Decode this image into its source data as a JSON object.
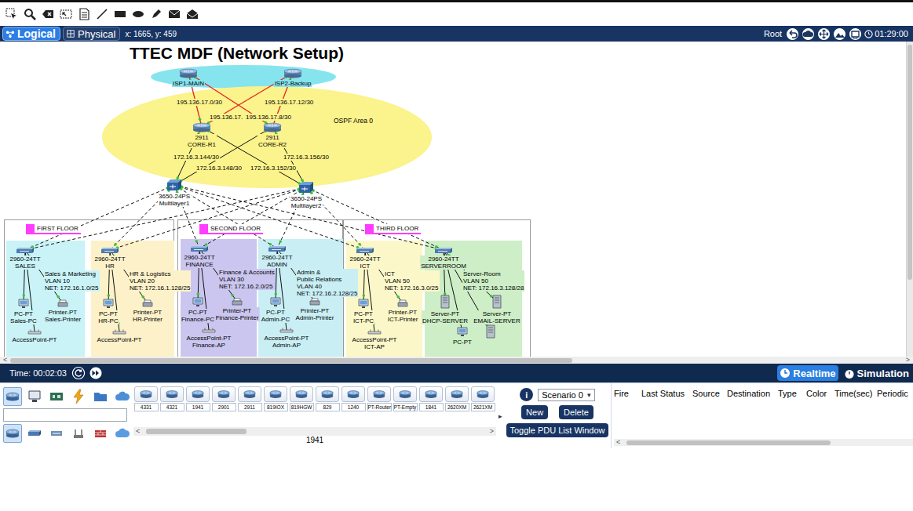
{
  "view_bar": {
    "tabs": [
      {
        "label": "Logical",
        "selected": true
      },
      {
        "label": "Physical",
        "selected": false
      }
    ],
    "cursor": "x: 1665, y: 459",
    "user": "Root",
    "clock": "01:29:00"
  },
  "diagram": {
    "title": "TTEC MDF (Network Setup)",
    "isps": [
      {
        "label": [
          "ISP1-MAIN"
        ]
      },
      {
        "label": [
          "ISP2-Backup"
        ]
      }
    ],
    "cores": [
      {
        "label": [
          "2911",
          "CORE-R1"
        ]
      },
      {
        "label": [
          "2911",
          "CORE-R2"
        ]
      }
    ],
    "distribution": [
      {
        "label": [
          "3650-24PS",
          "Multilayer1"
        ]
      },
      {
        "label": [
          "3650-24PS",
          "Multilayer2"
        ]
      }
    ],
    "ospf_area": "OSPF Area 0",
    "subnets": [
      "195.136.17.0/30",
      "195.136.17.12/30",
      "195.136.17.",
      "195.136.17.8/30",
      "172.16.3.144/30",
      "172.16.3.148/30",
      "172.16.3.152/30",
      "172.16.3.156/30"
    ],
    "link_kinds": {
      "isp_core": "serial",
      "core_distribution": "copper",
      "distribution_access": "dashed",
      "access_device": "copper"
    },
    "floors": [
      {
        "label": "FIRST FLOOR",
        "departments": [
          {
            "switch": [
              "2960-24TT",
              "SALES"
            ],
            "info": [
              "Sales & Marketing",
              "VLAN 10",
              "NET: 172.16.1.0/25"
            ],
            "color": "#c9f3f7",
            "devices": [
              {
                "kind": "pc",
                "label": [
                  "PC-PT",
                  "Sales-PC"
                ]
              },
              {
                "kind": "printer",
                "label": [
                  "Printer-PT",
                  "Sales-Printer"
                ]
              },
              {
                "kind": "ap",
                "label": [
                  "AccessPoint-PT"
                ]
              }
            ]
          },
          {
            "switch": [
              "2960-24TT",
              "HR"
            ],
            "info": [
              "HR & Logistics",
              "VLAN 20",
              "NET: 172.16.1.128/25"
            ],
            "color": "#fdf1c9",
            "devices": [
              {
                "kind": "pc",
                "label": [
                  "PC-PT",
                  "HR-PC"
                ]
              },
              {
                "kind": "printer",
                "label": [
                  "Printer-PT",
                  "HR-Printer"
                ]
              },
              {
                "kind": "ap",
                "label": [
                  "AccessPoint-PT"
                ]
              }
            ]
          }
        ]
      },
      {
        "label": "SECOND FLOOR",
        "departments": [
          {
            "switch": [
              "2960-24TT",
              "FINANCE"
            ],
            "info": [
              "Finance & Accounts",
              "VLAN 30",
              "NET: 172.16.2.0/25"
            ],
            "color": "#cbc6ef",
            "devices": [
              {
                "kind": "pc",
                "label": [
                  "PC-PT",
                  "Finance-PC"
                ]
              },
              {
                "kind": "printer",
                "label": [
                  "Printer-PT",
                  "Finance-Printer"
                ]
              },
              {
                "kind": "ap",
                "label": [
                  "AccessPoint-PT",
                  "Finance-AP"
                ]
              }
            ]
          },
          {
            "switch": [
              "2960-24TT",
              "ADMIN"
            ],
            "info": [
              "Admin &",
              "Public Relations",
              "VLAN 40",
              "NET: 172.16.2.128/25"
            ],
            "color": "#c9eff5",
            "devices": [
              {
                "kind": "pc",
                "label": [
                  "PC-PT",
                  "Admin-PC"
                ]
              },
              {
                "kind": "printer",
                "label": [
                  "Printer-PT",
                  "Admin-Printer"
                ]
              },
              {
                "kind": "ap",
                "label": [
                  "AccessPoint-PT",
                  "Admin-AP"
                ]
              }
            ]
          }
        ]
      },
      {
        "label": "THIRD FLOOR",
        "departments": [
          {
            "switch": [
              "2960-24TT",
              "ICT"
            ],
            "info": [
              "ICT",
              "VLAN 50",
              "NET: 172.16.3.0/25"
            ],
            "color": "#fbf7c8",
            "devices": [
              {
                "kind": "pc",
                "label": [
                  "PC-PT",
                  "ICT-PC"
                ]
              },
              {
                "kind": "printer",
                "label": [
                  "Printer-PT",
                  "ICT-Printer"
                ]
              },
              {
                "kind": "ap",
                "label": [
                  "AccessPoint-PT",
                  "ICT-AP"
                ]
              }
            ]
          },
          {
            "switch": [
              "2960-24TT",
              "SERVERROOM"
            ],
            "info": [
              "Server-Room",
              "VLAN 50",
              "NET: 172.16.3.128/28"
            ],
            "color": "#cdeec6",
            "devices": [
              {
                "kind": "server",
                "label": [
                  "Server-PT",
                  "DHCP-SERVER"
                ]
              },
              {
                "kind": "server",
                "label": [
                  "Server-PT",
                  "EMAIL-SERVER"
                ]
              },
              {
                "kind": "pc",
                "label": [
                  "PC-PT"
                ]
              },
              {
                "kind": "server",
                "label": []
              }
            ]
          }
        ]
      }
    ]
  },
  "sim_bar": {
    "time": "Time: 00:02:03",
    "modes": [
      {
        "label": "Realtime",
        "selected": true
      },
      {
        "label": "Simulation",
        "selected": false
      }
    ]
  },
  "device_panel": {
    "categories": [
      {
        "selected": true
      },
      {
        "selected": false
      },
      {
        "selected": false
      },
      {
        "selected": false
      },
      {
        "selected": false
      },
      {
        "selected": false
      }
    ],
    "subcategories": [
      {
        "selected": true
      },
      {
        "selected": false
      },
      {
        "selected": false
      },
      {
        "selected": false
      },
      {
        "selected": false
      },
      {
        "selected": false
      }
    ],
    "models": [
      "4331",
      "4321",
      "1941",
      "2901",
      "2911",
      "819IOX",
      "819HGW",
      "829",
      "1240",
      "PT-Router",
      "PT-Empty",
      "1841",
      "2620XM",
      "2621XM"
    ],
    "caption": "1941"
  },
  "scenario_panel": {
    "expander": "▸",
    "info": "i",
    "scenario": "Scenario 0",
    "dropdown": "▾",
    "buttons": [
      "New",
      "Delete"
    ],
    "toggle": "Toggle PDU List Window"
  },
  "pdu_table": {
    "columns": [
      "Fire",
      "Last Status",
      "Source",
      "Destination",
      "Type",
      "Color",
      "Time(sec)",
      "Periodic"
    ]
  },
  "scroll": {
    "left": "<",
    "right": ">"
  }
}
